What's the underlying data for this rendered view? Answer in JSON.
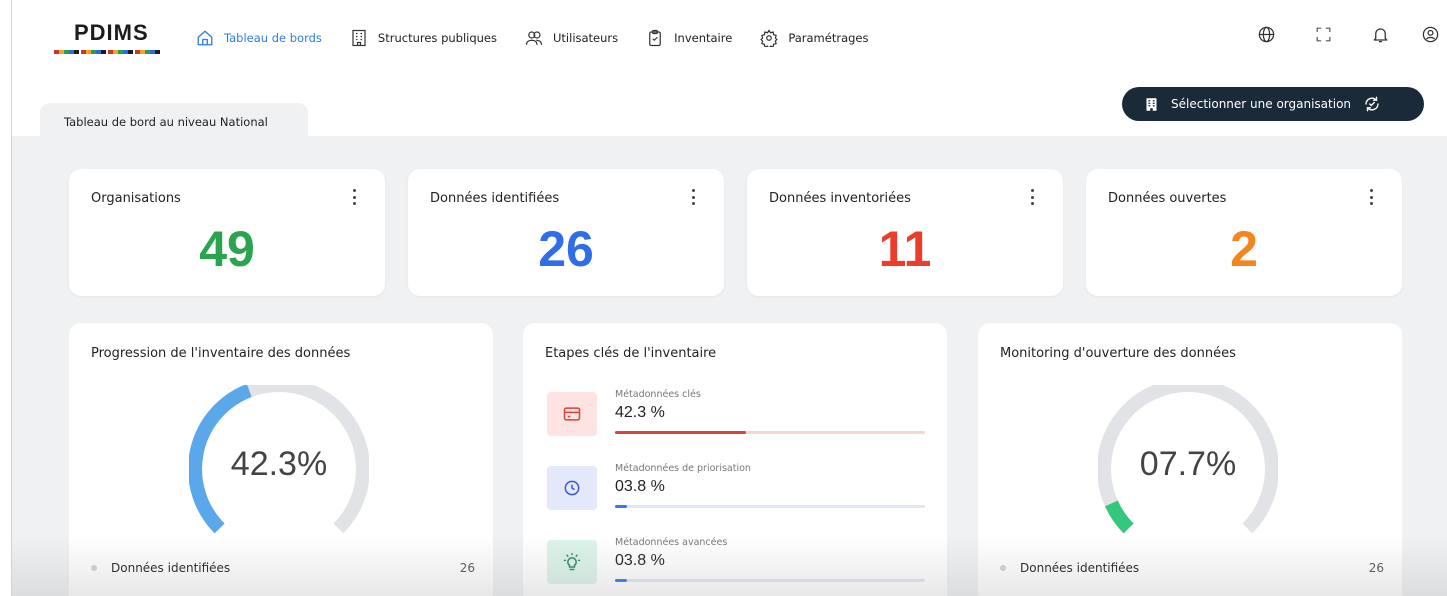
{
  "app": {
    "logo": "PDIMS"
  },
  "nav": {
    "items": [
      {
        "label": "Tableau de bords",
        "icon": "home-icon",
        "active": true
      },
      {
        "label": "Structures publiques",
        "icon": "building-icon"
      },
      {
        "label": "Utilisateurs",
        "icon": "users-icon"
      },
      {
        "label": "Inventaire",
        "icon": "clipboard-icon"
      },
      {
        "label": "Paramétrages",
        "icon": "gear-icon"
      }
    ],
    "right_icons": [
      "globe-icon",
      "fullscreen-icon",
      "bell-icon",
      "user-circle-icon"
    ]
  },
  "tab": {
    "label": "Tableau de bord au niveau National"
  },
  "org_button": {
    "label": "Sélectionner une organisation"
  },
  "kpis": [
    {
      "title": "Organisations",
      "value": "49",
      "color": "#2aa44f"
    },
    {
      "title": "Données identifiées",
      "value": "26",
      "color": "#2f6ee6"
    },
    {
      "title": "Données inventoriées",
      "value": "11",
      "color": "#ea3d2b"
    },
    {
      "title": "Données ouvertes",
      "value": "2",
      "color": "#f5861f"
    }
  ],
  "progression": {
    "title": "Progression de l'inventaire des données",
    "percent_label": "42.3%",
    "percent": 42.3,
    "arc_color": "#5aa8ea",
    "legend": {
      "label": "Données identifiées",
      "value": "26"
    }
  },
  "etapes": {
    "title": "Etapes clés de l'inventaire",
    "steps": [
      {
        "label": "Métadonnées clés",
        "value": "42.3 %",
        "percent": 42.3,
        "icon": "card-icon",
        "bg": "#fde3e1",
        "icon_color": "#d8433a",
        "track": "#f6d6d3",
        "fill": "#d8433a"
      },
      {
        "label": "Métadonnées de priorisation",
        "value": "03.8 %",
        "percent": 3.8,
        "icon": "clock-icon",
        "bg": "#e3e8fb",
        "icon_color": "#3f57c9",
        "track": "#dfe6f7",
        "fill": "#2f7de1"
      },
      {
        "label": "Métadonnées avancées",
        "value": "03.8 %",
        "percent": 3.8,
        "icon": "bulb-icon",
        "bg": "#dcf4ea",
        "icon_color": "#2c8a5e",
        "track": "#dfe6f7",
        "fill": "#2f7de1"
      }
    ]
  },
  "monitoring": {
    "title": "Monitoring d'ouverture des données",
    "percent_label": "07.7%",
    "percent": 7.7,
    "arc_color": "#35c77d",
    "legend": {
      "label": "Données identifiées",
      "value": "26"
    }
  }
}
